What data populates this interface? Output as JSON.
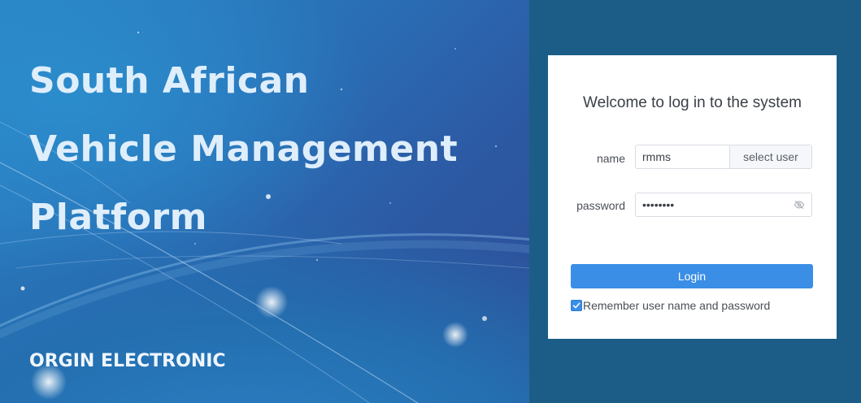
{
  "hero": {
    "title_lines": [
      "South African",
      "Vehicle Management",
      "Platform"
    ],
    "brand": "ORGIN ELECTRONIC"
  },
  "login": {
    "welcome": "Welcome to log in to the system",
    "name_label": "name",
    "name_value": "rmms",
    "select_user_label": "select user",
    "password_label": "password",
    "password_value": "********",
    "login_label": "Login",
    "remember_label": "Remember user name and password",
    "remember_checked": true
  },
  "colors": {
    "page_background": "#1b5d86",
    "accent": "#3a8ee6",
    "card_background": "#ffffff"
  },
  "icons": {
    "password_toggle": "eye-off-icon",
    "checkbox": "checkmark-icon"
  }
}
